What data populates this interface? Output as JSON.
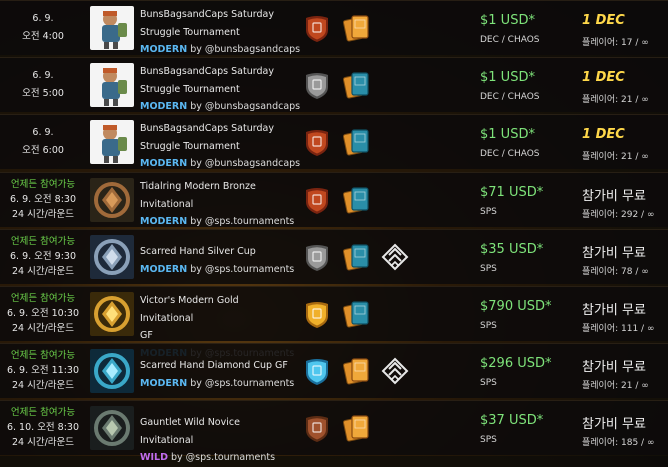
{
  "tournaments": [
    {
      "available": "",
      "date": "6. 9.",
      "time": "오전 4:00",
      "duration": "",
      "name_l1": "BunsBagsandCaps Saturday",
      "name_l2": "Struggle Tournament",
      "format": "MODERN",
      "by": "by @bunsbagsandcaps",
      "thumb": "bunsbags",
      "league": "bronze-shield-icon",
      "edition": "orange-cards-icon",
      "extra": "",
      "prize": "$1 USD*",
      "prize_sub": "DEC / CHAOS",
      "fee": "1 DEC",
      "players": "플레이어: 17 / ∞"
    },
    {
      "available": "",
      "date": "6. 9.",
      "time": "오전 5:00",
      "duration": "",
      "name_l1": "BunsBagsandCaps Saturday",
      "name_l2": "Struggle Tournament",
      "format": "MODERN",
      "by": "by @bunsbagsandcaps",
      "thumb": "bunsbags",
      "league": "silver-shield-icon",
      "edition": "teal-cards-icon",
      "extra": "",
      "prize": "$1 USD*",
      "prize_sub": "DEC / CHAOS",
      "fee": "1 DEC",
      "players": "플레이어: 21 / ∞"
    },
    {
      "available": "",
      "date": "6. 9.",
      "time": "오전 6:00",
      "duration": "",
      "name_l1": "BunsBagsandCaps Saturday",
      "name_l2": "Struggle Tournament",
      "format": "MODERN",
      "by": "by @bunsbagsandcaps",
      "thumb": "bunsbags",
      "league": "bronze-shield-icon",
      "edition": "teal-cards-icon",
      "extra": "",
      "prize": "$1 USD*",
      "prize_sub": "DEC / CHAOS",
      "fee": "1 DEC",
      "players": "플레이어: 21 / ∞"
    },
    {
      "available": "언제든 참여가능",
      "date": "6. 9.",
      "time": "오전 8:30",
      "duration": "24 시간/라운드",
      "name_l1": "Tidalring Modern Bronze",
      "name_l2": "Invitational",
      "format": "MODERN",
      "by": "by @sps.tournaments",
      "thumb": "bronze",
      "league": "bronze-shield-icon",
      "edition": "teal-cards-icon",
      "extra": "",
      "prize": "$71 USD*",
      "prize_sub": "SPS",
      "fee": "참가비 무료",
      "players": "플레이어: 292 / ∞"
    },
    {
      "available": "언제든 참여가능",
      "date": "6. 9.",
      "time": "오전 9:30",
      "duration": "24 시간/라운드",
      "name_l1": "Scarred Hand Silver Cup",
      "name_l2": "",
      "format": "MODERN",
      "by": "by @sps.tournaments",
      "thumb": "silver",
      "league": "silver-shield-icon",
      "edition": "teal-cards-icon",
      "extra": "diamond-chevron-icon",
      "prize": "$35 USD*",
      "prize_sub": "SPS",
      "fee": "참가비 무료",
      "players": "플레이어: 78 / ∞"
    },
    {
      "available": "언제든 참여가능",
      "date": "6. 9.",
      "time": "오전 10:30",
      "duration": "24 시간/라운드",
      "name_l1": "Victor's Modern Gold Invitational",
      "name_l2": "GF",
      "format": "MODERN",
      "by": "by @sps.tournaments",
      "thumb": "gold",
      "league": "gold-shield-icon",
      "edition": "teal-cards-icon",
      "extra": "",
      "prize": "$790 USD*",
      "prize_sub": "SPS",
      "fee": "참가비 무료",
      "players": "플레이어: 111 / ∞"
    },
    {
      "available": "언제든 참여가능",
      "date": "6. 9.",
      "time": "오전 11:30",
      "duration": "24 시간/라운드",
      "name_l1": "Scarred Hand Diamond Cup GF",
      "name_l2": "",
      "format": "MODERN",
      "by": "by @sps.tournaments",
      "thumb": "diamond",
      "league": "diamond-shield-icon",
      "edition": "orange-cards-icon",
      "extra": "diamond-chevron-icon",
      "prize": "$296 USD*",
      "prize_sub": "SPS",
      "fee": "참가비 무료",
      "players": "플레이어: 21 / ∞"
    },
    {
      "available": "언제든 참여가능",
      "date": "6. 10.",
      "time": "오전 8:30",
      "duration": "24 시간/라운드",
      "name_l1": "Gauntlet Wild Novice Invitational",
      "name_l2": "",
      "format": "WILD",
      "by": "by @sps.tournaments",
      "thumb": "novice",
      "league": "novice-shield-icon",
      "edition": "orange-cards-icon",
      "extra": "",
      "prize": "$37 USD*",
      "prize_sub": "SPS",
      "fee": "참가비 무료",
      "players": "플레이어: 185 / ∞"
    }
  ],
  "colors": {
    "prize": "#7ee37a",
    "available": "#6bd04a",
    "modern": "#5bb8f2",
    "wild": "#c06df0",
    "dec_fee": "#ffd84a"
  }
}
